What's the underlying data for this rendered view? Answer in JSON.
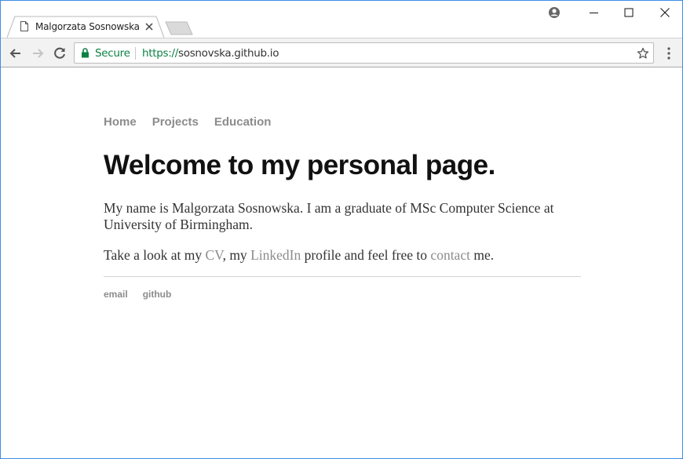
{
  "browser": {
    "tab_title": "Malgorzata Sosnowska",
    "security_label": "Secure",
    "url_scheme": "https://",
    "url_host": "sosnovska.github.io",
    "colors": {
      "secure": "#0b8043",
      "window_border": "#3c8ee6"
    }
  },
  "page": {
    "nav": {
      "home": "Home",
      "projects": "Projects",
      "education": "Education"
    },
    "heading": "Welcome to my personal page.",
    "intro": "My name is Malgorzata Sosnowska. I am a graduate of MSc Computer Science at University of Birmingham.",
    "cta": {
      "t1": "Take a look at my ",
      "cv": "CV",
      "t2": ", my ",
      "linkedin": "LinkedIn",
      "t3": " profile and feel free to ",
      "contact": "contact",
      "t4": " me."
    },
    "footer": {
      "email": "email",
      "github": "github"
    },
    "colors": {
      "link": "#8c8c8c",
      "heading": "#111111",
      "text": "#333333"
    }
  }
}
